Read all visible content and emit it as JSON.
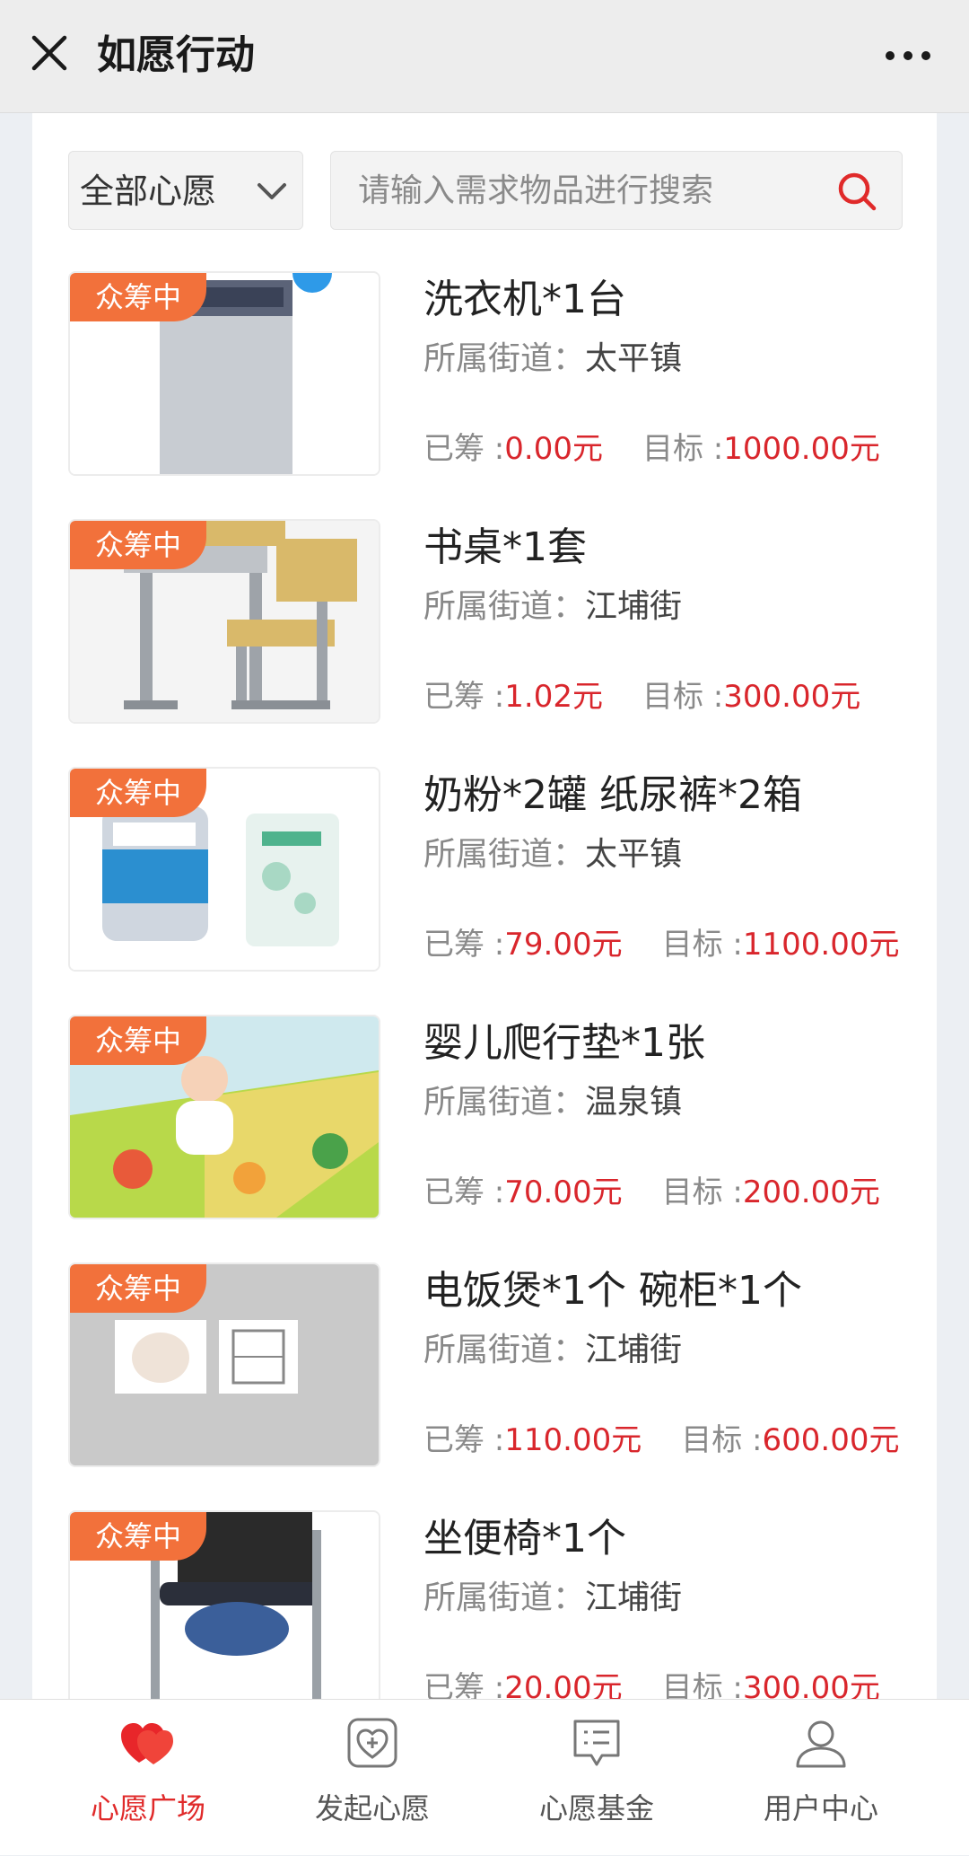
{
  "header": {
    "title": "如愿行动"
  },
  "filter": {
    "selected": "全部心愿"
  },
  "search": {
    "placeholder": "请输入需求物品进行搜索"
  },
  "labels": {
    "street": "所属街道：",
    "raised": "已筹 :",
    "target": "目标 :"
  },
  "items": [
    {
      "status": "众筹中",
      "title": "洗衣机*1台",
      "street": "太平镇",
      "raised": "0.00元",
      "target": "1000.00元"
    },
    {
      "status": "众筹中",
      "title": "书桌*1套",
      "street": "江埔街",
      "raised": "1.02元",
      "target": "300.00元"
    },
    {
      "status": "众筹中",
      "title": "奶粉*2罐 纸尿裤*2箱",
      "street": "太平镇",
      "raised": "79.00元",
      "target": "1100.00元"
    },
    {
      "status": "众筹中",
      "title": "婴儿爬行垫*1张",
      "street": "温泉镇",
      "raised": "70.00元",
      "target": "200.00元"
    },
    {
      "status": "众筹中",
      "title": "电饭煲*1个 碗柜*1个",
      "street": "江埔街",
      "raised": "110.00元",
      "target": "600.00元"
    },
    {
      "status": "众筹中",
      "title": "坐便椅*1个",
      "street": "江埔街",
      "raised": "20.00元",
      "target": "300.00元"
    }
  ],
  "nav": [
    {
      "label": "心愿广场",
      "icon": "hearts-icon",
      "active": true
    },
    {
      "label": "发起心愿",
      "icon": "add-wish-icon",
      "active": false
    },
    {
      "label": "心愿基金",
      "icon": "fund-list-icon",
      "active": false
    },
    {
      "label": "用户中心",
      "icon": "user-icon",
      "active": false
    }
  ],
  "colors": {
    "accent": "#e02a2a",
    "badge": "#f2713b",
    "money": "#d9262c"
  }
}
